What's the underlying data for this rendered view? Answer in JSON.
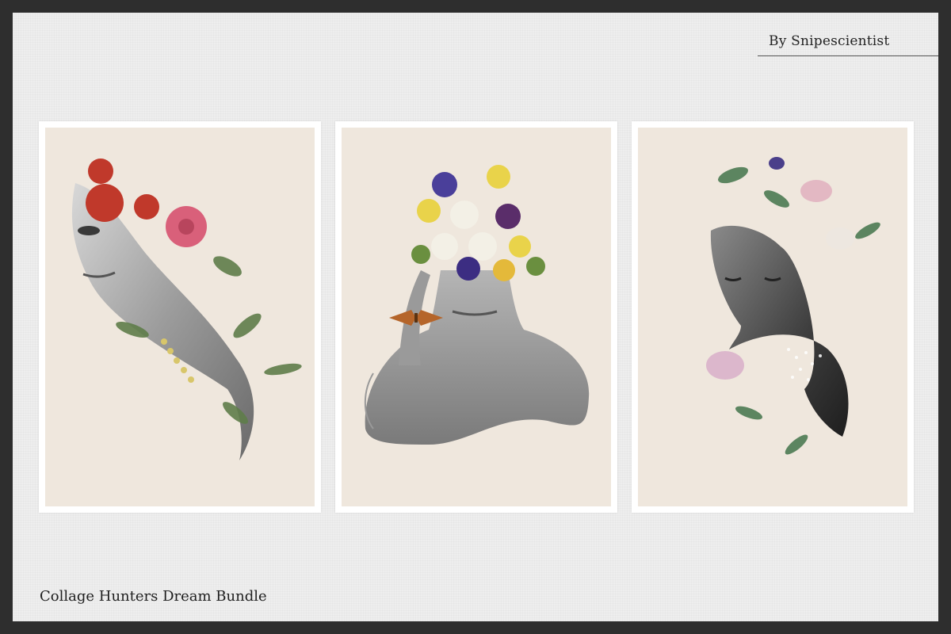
{
  "header": {
    "author": "By Snipescientist"
  },
  "footer": {
    "title": "Collage Hunters Dream Bundle"
  },
  "artworks": [
    {
      "subject": "profile face with red roses and foliage"
    },
    {
      "subject": "woman holding face with pansies bouquet and moth"
    },
    {
      "subject": "woman with eyes closed, pink lilies and sparkles"
    }
  ],
  "colors": {
    "frame_bg": "#2e2e2e",
    "sheet": "#eeeeee",
    "paper": "#efe7dd",
    "text": "#1e1e1e"
  }
}
